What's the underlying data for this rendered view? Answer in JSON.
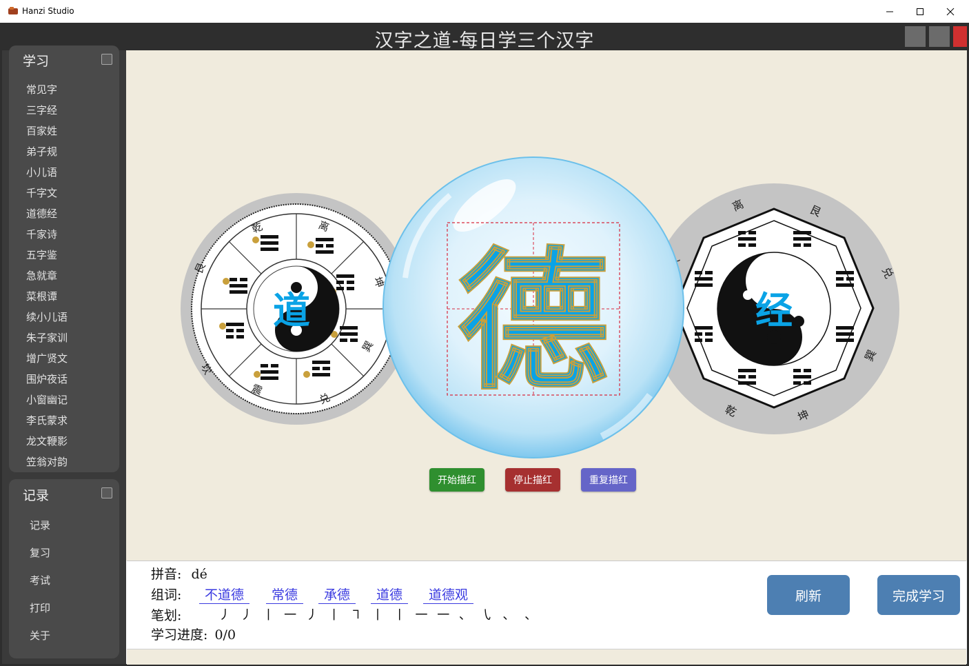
{
  "window": {
    "title": "Hanzi Studio",
    "minimize": "—",
    "maximize": "☐",
    "close": "✕"
  },
  "header": {
    "title": "汉字之道-每日学三个汉字"
  },
  "sidebar": {
    "learn": {
      "title": "学习",
      "items": [
        "常见字",
        "三字经",
        "百家姓",
        "弟子规",
        "小儿语",
        "千字文",
        "道德经",
        "千家诗",
        "五字鉴",
        "急就章",
        "菜根谭",
        "续小儿语",
        "朱子家训",
        "增广贤文",
        "围炉夜话",
        "小窗幽记",
        "李氏蒙求",
        "龙文鞭影",
        "笠翁对韵"
      ]
    },
    "records": {
      "title": "记录",
      "items": [
        "记录",
        "复习",
        "考试",
        "打印",
        "关于"
      ]
    }
  },
  "stage": {
    "left_char": "道",
    "center_char": "德",
    "right_char": "经",
    "left_trigram_labels": [
      "乾",
      "坎",
      "艮",
      "震",
      "巽",
      "离",
      "坤",
      "兑"
    ],
    "right_trigram_labels": [
      "离",
      "坤",
      "兑",
      "乾",
      "坎",
      "艮",
      "震",
      "巽"
    ]
  },
  "controls": {
    "start": "开始描红",
    "stop": "停止描红",
    "repeat": "重复描红",
    "colors": {
      "start": "#2f8f2f",
      "stop": "#a63030",
      "repeat": "#6565c8"
    }
  },
  "info": {
    "pinyin_label": "拼音:",
    "pinyin": "dé",
    "words_label": "组词:",
    "words": [
      "不道德",
      "常德",
      "承德",
      "道德",
      "道德观"
    ],
    "strokes_label": "笔划:",
    "strokes": "丿 丿 丨 一 丿 丨 ㇕ 丨 丨 一 一 、 ㇂ 、 、",
    "progress_label": "学习进度:",
    "progress": "0/0",
    "refresh": "刷新",
    "finish": "完成学习"
  },
  "colors": {
    "accent": "#0aa3e6",
    "header": "#2e2e2e",
    "sidebar": "#3a3a3a",
    "canvas": "#f0ebdd",
    "button": "#4d7fb2"
  }
}
